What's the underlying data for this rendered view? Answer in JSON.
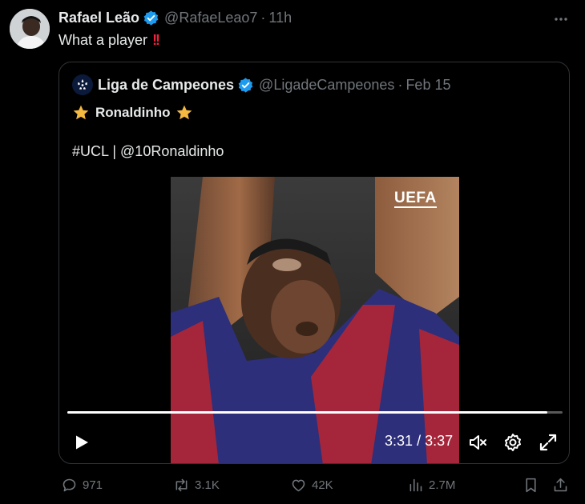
{
  "tweet": {
    "author_name": "Rafael Leão",
    "handle": "@RafaeLeao7",
    "separator": "·",
    "time": "11h",
    "text": "What a player",
    "emoji": "!!"
  },
  "quote": {
    "author_name": "Liga de Campeones",
    "handle": "@LigadeCampeones",
    "separator": "·",
    "date": "Feb 15",
    "title": "Ronaldinho",
    "tags": "#UCL | @10Ronaldinho",
    "video": {
      "watermark": "UEFA",
      "current_time": "3:31",
      "time_separator": "/",
      "duration": "3:37",
      "progress_fraction": 0.97
    }
  },
  "actions": {
    "replies": "971",
    "reposts": "3.1K",
    "likes": "42K",
    "views": "2.7M"
  },
  "icons": {
    "verified": "verified-badge-icon",
    "more": "more-options-icon",
    "play": "play-icon",
    "mute": "volume-muted-icon",
    "settings": "settings-icon",
    "fullscreen": "fullscreen-icon",
    "reply": "reply-icon",
    "repost": "repost-icon",
    "like": "heart-icon",
    "views": "views-icon",
    "bookmark": "bookmark-icon",
    "share": "share-icon"
  },
  "colors": {
    "background": "#000000",
    "text": "#e7e9ea",
    "muted": "#71767b",
    "verified": "#1d9bf0",
    "border": "#2f3336",
    "emoji_red": "#ef233c",
    "star": "#f5b942"
  }
}
